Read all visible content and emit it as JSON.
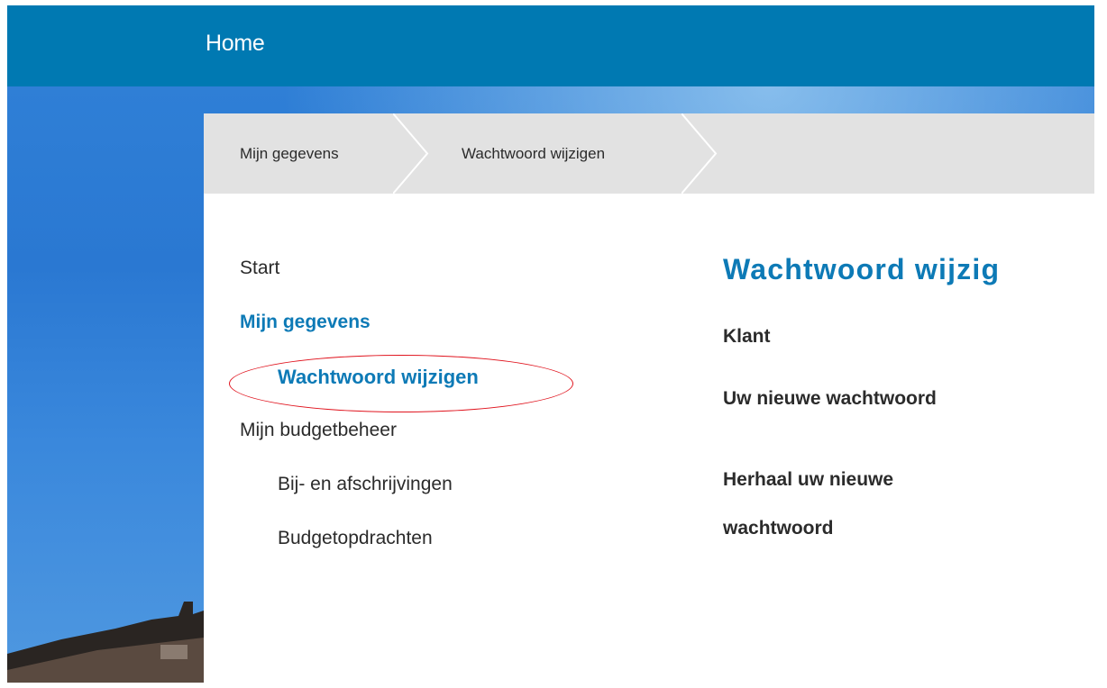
{
  "header": {
    "home_label": "Home"
  },
  "breadcrumb": {
    "items": [
      {
        "label": "Mijn gegevens"
      },
      {
        "label": "Wachtwoord wijzigen"
      }
    ]
  },
  "sidebar": {
    "items": [
      {
        "label": "Start",
        "active": false,
        "level": 1
      },
      {
        "label": "Mijn gegevens",
        "active": true,
        "level": 1
      },
      {
        "label": "Wachtwoord wijzigen",
        "active": true,
        "level": 2
      },
      {
        "label": "Mijn budgetbeheer",
        "active": false,
        "level": 1
      },
      {
        "label": "Bij- en afschrijvingen",
        "active": false,
        "level": 2
      },
      {
        "label": "Budgetopdrachten",
        "active": false,
        "level": 2
      }
    ]
  },
  "main": {
    "title": "Wachtwoord wijzig",
    "fields": [
      {
        "label": "Klant"
      },
      {
        "label": "Uw nieuwe wachtwoord"
      },
      {
        "label": "Herhaal uw nieuwe wachtwoord"
      }
    ]
  },
  "colors": {
    "header_blue": "#0079b2",
    "link_blue": "#0d7ab6",
    "breadcrumb_gray": "#e2e2e2",
    "annotation_red": "#e0141e",
    "text_dark": "#2b2b2b"
  },
  "annotation": {
    "type": "red-ellipse",
    "target": "Wachtwoord wijzigen"
  }
}
